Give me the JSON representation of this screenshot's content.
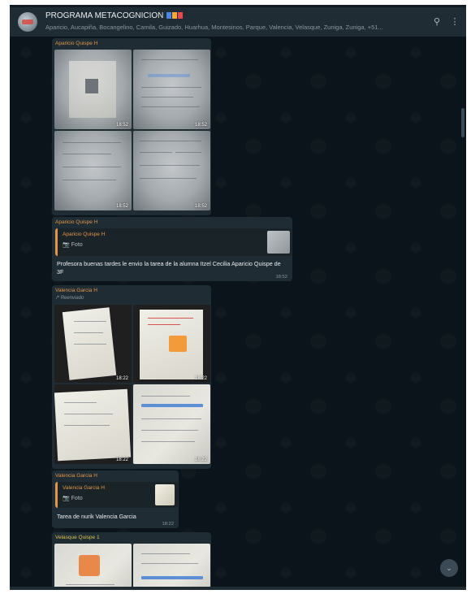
{
  "header": {
    "group_name": "PROGRAMA METACOGNICION",
    "flag_colors": [
      "#4a86e8",
      "#f6a83b",
      "#e84a4a"
    ],
    "members": "Aparicio, Aucapiña, Bocangelino, Camila, Guizado, Huarhua, Montesinos, Parque, Valencia, Velasque, Zuniga, Zuniga, +51...",
    "search_icon": "🔍",
    "menu_icon": "⋮"
  },
  "messages": {
    "album1": {
      "sender": "Aparicio Quispe H",
      "times": [
        "18:52",
        "18:52",
        "18:52",
        "18:52"
      ]
    },
    "reply1": {
      "sender": "Aparicio Quispe H",
      "quoted_sender": "Aparicio Quispe H",
      "quoted_type": "📷 Foto",
      "text": "Profesora buenas tardes le envio la tarea de la alumna Itzel Cecilia Aparicio Quispe de 3F",
      "time": "18:52"
    },
    "album2": {
      "sender": "Valencia Garcia H",
      "forwarded": "↱ Reenviado",
      "times": [
        "18:22",
        "18:22",
        "18:22",
        "18:22"
      ]
    },
    "reply2": {
      "sender": "Valencia Garcia H",
      "quoted_sender": "Valencia Garcia H",
      "quoted_type": "📷 Foto",
      "text": "Tarea de nurik Valencia Garcia",
      "time": "18:22"
    },
    "album3": {
      "sender": "Velasque Quispe 1"
    }
  },
  "scroll_down_icon": "⌄"
}
